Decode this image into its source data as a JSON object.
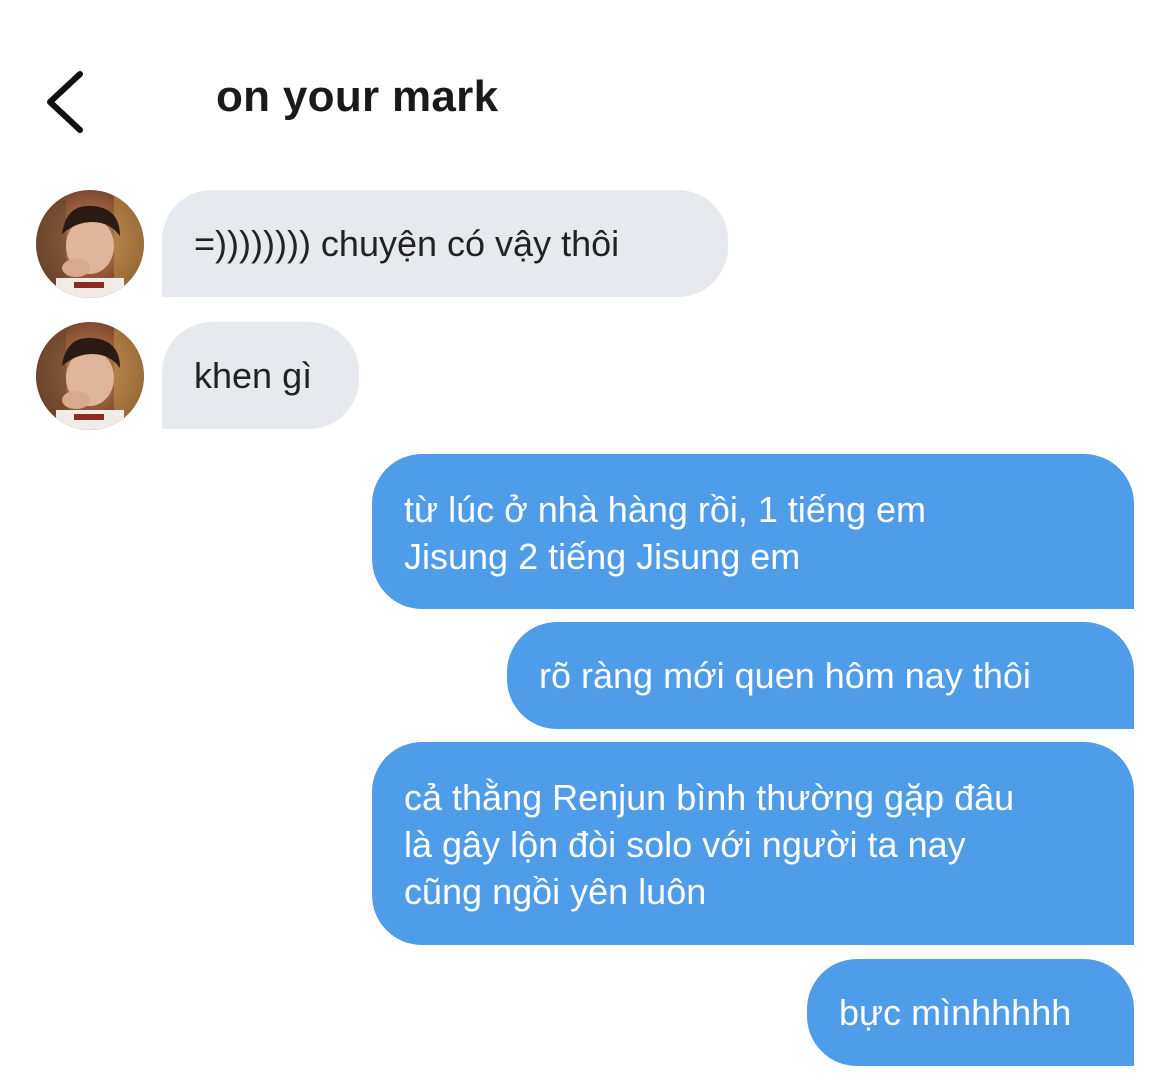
{
  "header": {
    "title": "on your mark",
    "back_icon": "chevron-left-icon"
  },
  "colors": {
    "incoming_bubble": "#e6eaee",
    "outgoing_bubble": "#4f9ce8",
    "outgoing_text": "#ffffff",
    "incoming_text": "#222222"
  },
  "messages": [
    {
      "direction": "incoming",
      "lines": [
        "=)))))))) chuyện có vậy thôi"
      ]
    },
    {
      "direction": "incoming",
      "lines": [
        "khen gì"
      ]
    },
    {
      "direction": "outgoing",
      "lines": [
        "từ lúc ở nhà hàng rồi, 1 tiếng em",
        "Jisung 2 tiếng Jisung em"
      ]
    },
    {
      "direction": "outgoing",
      "lines": [
        "rõ ràng mới quen hôm nay thôi"
      ]
    },
    {
      "direction": "outgoing",
      "lines": [
        "cả thằng Renjun bình thường gặp đâu",
        "là gây lộn đòi solo với người ta nay",
        "cũng ngồi yên luôn"
      ]
    },
    {
      "direction": "outgoing",
      "lines": [
        "bực mìnhhhhh"
      ]
    }
  ]
}
